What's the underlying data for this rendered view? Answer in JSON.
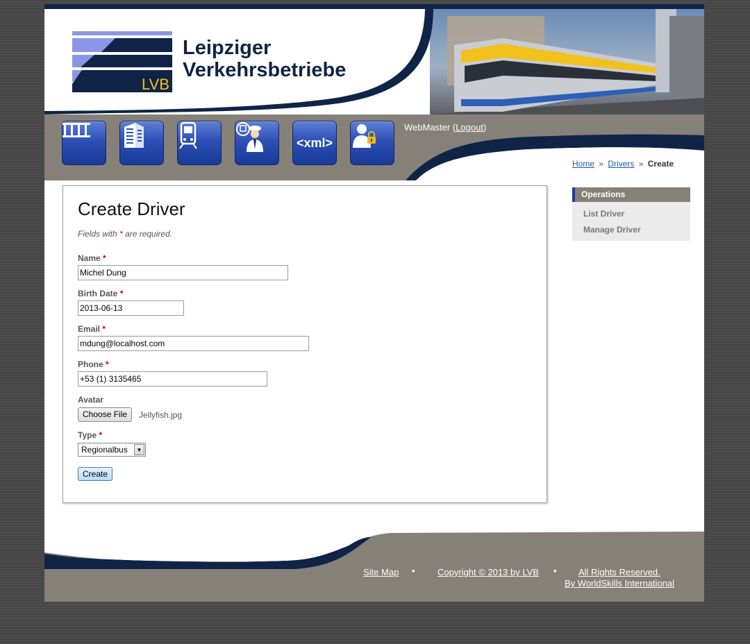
{
  "header": {
    "logo_badge": "LVB",
    "title_line1": "Leipziger",
    "title_line2": "Verkehrsbetriebe"
  },
  "nav": {
    "items": [
      {
        "icon": "tram-stop-icon"
      },
      {
        "icon": "depot-building-icon"
      },
      {
        "icon": "tram-icon"
      },
      {
        "icon": "driver-icon"
      },
      {
        "icon": "xml-icon",
        "label": "<xml>"
      },
      {
        "icon": "user-key-icon"
      }
    ]
  },
  "user": {
    "name": "WebMaster",
    "open_paren": " (",
    "logout_label": "Logout",
    "close_paren": ")"
  },
  "breadcrumb": {
    "home": "Home",
    "sep1": "»",
    "drivers": "Drivers",
    "sep2": "»",
    "current": "Create"
  },
  "form": {
    "title": "Create Driver",
    "required_note_prefix": "Fields with ",
    "required_star": "*",
    "required_note_suffix": " are required.",
    "fields": {
      "name": {
        "label": "Name",
        "value": "Michel Dung"
      },
      "birth_date": {
        "label": "Birth Date",
        "value": "2013-06-13"
      },
      "email": {
        "label": "Email",
        "value": "mdung@localhost.com"
      },
      "phone": {
        "label": "Phone",
        "value": "+53 (1) 3135465"
      },
      "avatar": {
        "label": "Avatar",
        "button": "Choose File",
        "file": "Jellyfish.jpg"
      },
      "type": {
        "label": "Type",
        "value": "Regionalbus"
      }
    },
    "submit_label": "Create"
  },
  "operations": {
    "title": "Operations",
    "items": [
      "List Driver",
      "Manage Driver"
    ]
  },
  "footer": {
    "site_map": "Site Map",
    "copyright": "Copyright © 2013 by LVB",
    "rights": "All Rights Reserved.",
    "by": "By WorldSkills International",
    "bullet": "•"
  },
  "colors": {
    "navy": "#0f2446",
    "nav_gray": "#868178",
    "button_blue": "#2d4fb6",
    "link_blue": "#1a5aa8",
    "required_red": "#cc0000"
  }
}
